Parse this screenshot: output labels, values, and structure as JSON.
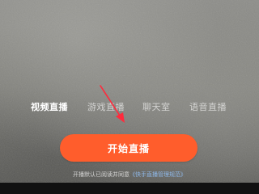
{
  "mode_tabs": [
    {
      "label": "视频直播",
      "active": true
    },
    {
      "label": "游戏直播",
      "active": false
    },
    {
      "label": "聊天室",
      "active": false
    },
    {
      "label": "语音直播",
      "active": false
    }
  ],
  "start_button": {
    "label": "开始直播"
  },
  "agreement": {
    "prefix": "开播默认已阅读并同意",
    "link": "《快手直播管理规范》"
  },
  "colors": {
    "accent": "#ff5d2c",
    "arrow": "#ff2a3c",
    "link": "#8fb9ea"
  },
  "icons": {
    "annotation_arrow": "arrow-icon"
  }
}
